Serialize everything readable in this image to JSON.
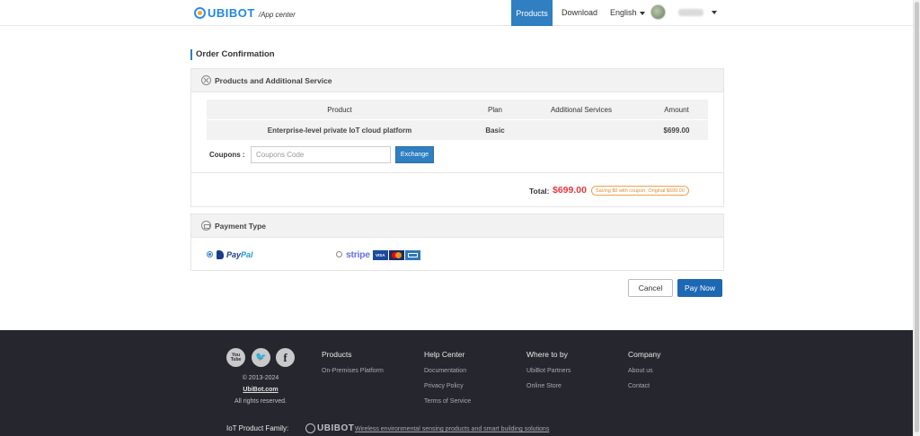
{
  "header": {
    "logo_text": "UBIBOT",
    "logo_sub": "/App center",
    "nav": {
      "products": "Products",
      "download": "Download",
      "language": "English"
    }
  },
  "page": {
    "title": "Order Confirmation"
  },
  "products_section": {
    "title": "Products and Additional Service",
    "columns": [
      "Product",
      "Plan",
      "Additional Services",
      "Amount"
    ],
    "rows": [
      {
        "product": "Enterprise-level private IoT cloud platform",
        "plan": "Basic",
        "services": "",
        "amount": "$699.00"
      }
    ],
    "coupons_label": "Coupons :",
    "coupons_placeholder": "Coupons Code",
    "exchange_label": "Exchange",
    "total_label": "Total:",
    "total_amount": "$699.00",
    "saving_note": "Saving $0 with coupon, Original $699.00"
  },
  "payment_section": {
    "title": "Payment Type",
    "options": [
      {
        "label_a": "Pay",
        "label_b": "Pal",
        "selected": true
      },
      {
        "label": "stripe",
        "cards": [
          "VISA",
          "MC",
          "AMEX"
        ],
        "selected": false
      }
    ]
  },
  "actions": {
    "cancel": "Cancel",
    "pay_now": "Pay Now"
  },
  "footer": {
    "social": [
      "You Tube",
      "twitter",
      "f"
    ],
    "copyright": "© 2013-2024",
    "site": "UbiBot.com",
    "rights": "All rights reserved.",
    "columns": [
      {
        "title": "Products",
        "links": [
          "On-Premises Platform"
        ]
      },
      {
        "title": "Help Center",
        "links": [
          "Documentation",
          "Privacy Policy",
          "Terms of Service"
        ]
      },
      {
        "title": "Where to by",
        "links": [
          "UbiBot Partners",
          "Online Store"
        ]
      },
      {
        "title": "Company",
        "links": [
          "About us",
          "Contact"
        ]
      }
    ],
    "family_label": "IoT Product Family:",
    "family_logo": "UBIBOT",
    "family_link": "Wireless environmental sensing products and smart building solutions"
  },
  "colors": {
    "brand_blue": "#2f7fc1",
    "total_red": "#e4393c",
    "footer_bg": "#26272e"
  }
}
